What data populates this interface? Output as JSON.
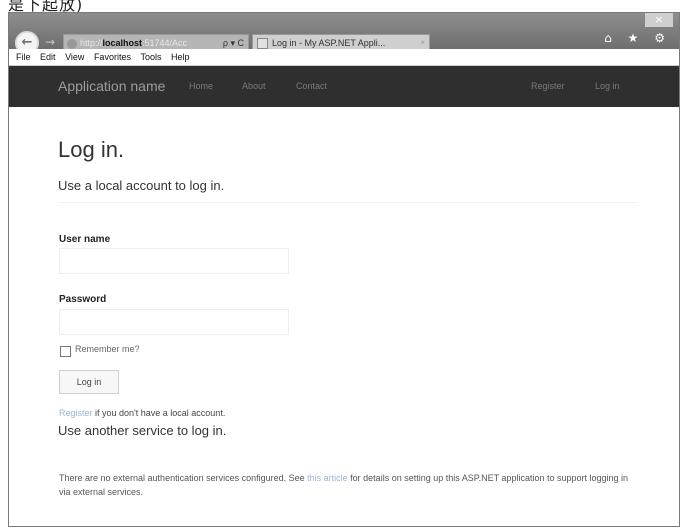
{
  "page_top_text": "是下起放)",
  "browser": {
    "close_glyph": "×",
    "back_glyph": "←",
    "forward_glyph": "→",
    "address": {
      "scheme": "http://",
      "host": "localhost",
      "port": ":51744/Acc",
      "controls": "ρ ▾ C"
    },
    "tab": {
      "title": "Log in - My ASP.NET Appli...",
      "close": "×"
    },
    "toolbar_icons": "⌂ ★ ⚙"
  },
  "menu": [
    "File",
    "Edit",
    "View",
    "Favorites",
    "Tools",
    "Help"
  ],
  "navbar": {
    "brand": "Application name",
    "links": [
      "Home",
      "About",
      "Contact"
    ],
    "right_links": [
      "Register",
      "Log in"
    ]
  },
  "content": {
    "title": "Log in.",
    "subtitle": "Use a local account to log in.",
    "username_label": "User name",
    "password_label": "Password",
    "remember_label": "Remember me?",
    "login_button": "Log in",
    "register_link": "Register",
    "register_suffix": " if you don't have a local account.",
    "external_title": "Use another service to log in.",
    "info_prefix": "There are no external authentication services configured. See ",
    "info_link": "this article",
    "info_suffix": " for details on setting up this ASP.NET application to support logging in via external services."
  }
}
